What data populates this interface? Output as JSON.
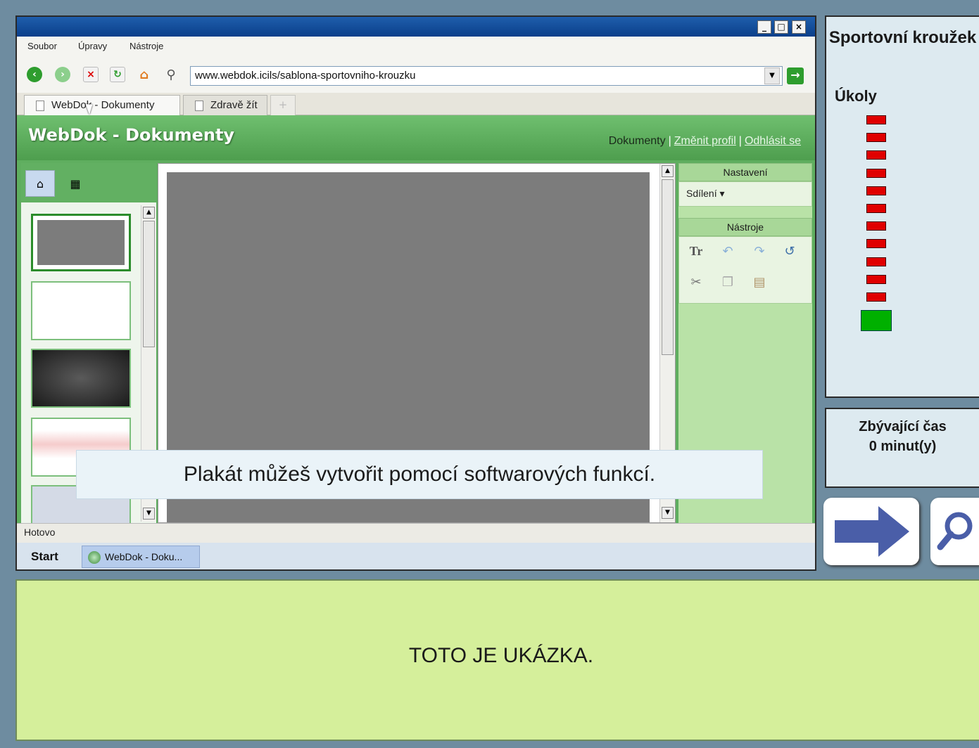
{
  "browser": {
    "window_buttons": {
      "minimize": "_",
      "restore": "□",
      "close": "×"
    },
    "menu": [
      "Soubor",
      "Úpravy",
      "Nástroje"
    ],
    "address": "www.webdok.icils/sablona-sportovniho-krouzku",
    "tabs": [
      {
        "label": "WebDok - Dokumenty"
      },
      {
        "label": "Zdravě žít"
      }
    ],
    "new_tab": "+",
    "status": "Hotovo"
  },
  "webpage": {
    "title": "WebDok - Dokumenty",
    "links": {
      "documents": "Dokumenty",
      "change_profile": "Změnit profil",
      "logout": "Odhlásit se"
    },
    "settings": {
      "title": "Nastavení",
      "share": "Sdílení ▾"
    },
    "tools": {
      "title": "Nástroje"
    }
  },
  "taskbar": {
    "start": "Start",
    "task": "WebDok - Doku..."
  },
  "tooltip": "Plakát můžeš vytvořit pomocí softwarových funkcí.",
  "sidebar": {
    "title": "Sportovní kroužek",
    "tasks_label": "Úkoly",
    "tasks_total": 12,
    "tasks_current": 12,
    "time_label": "Zbývající čas",
    "time_value": "0 minut(y)"
  },
  "instruction": "TOTO JE UKÁZKA.",
  "colors": {
    "task_pending": "#e00000",
    "task_current": "#00b000",
    "accent": "#4a5ea8"
  }
}
